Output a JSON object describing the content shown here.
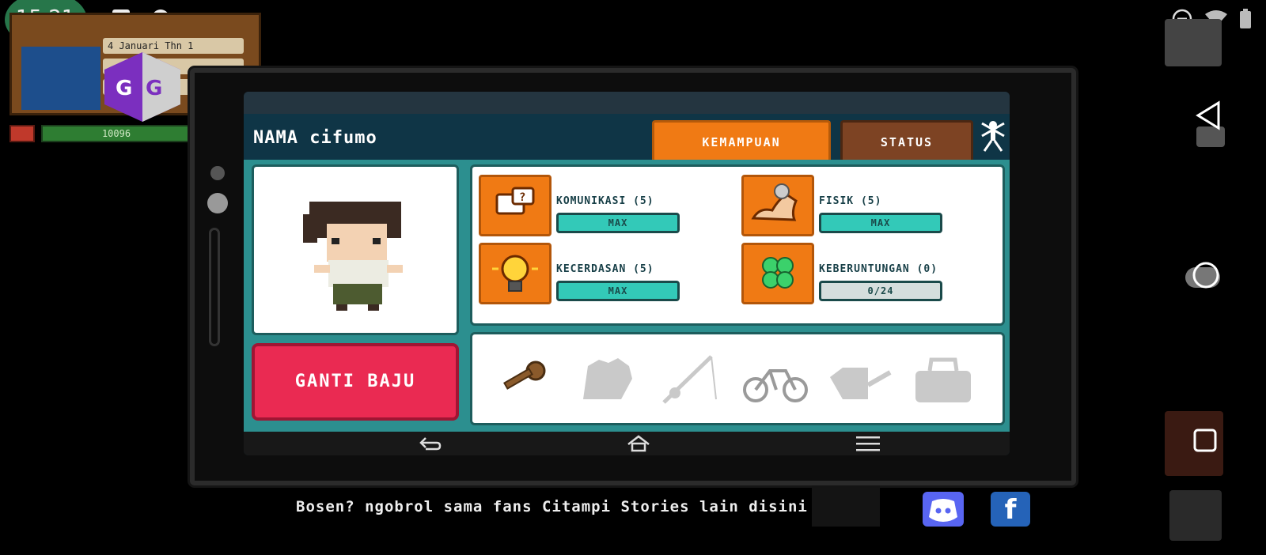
{
  "status_bar": {
    "time": "15.21",
    "left_icons": [
      "a-box-icon",
      "gg-small-icon"
    ],
    "right_icons": [
      "do-not-disturb-icon",
      "wifi-icon",
      "battery-icon"
    ]
  },
  "background_hud": {
    "date_label": "4 Januari Thn 1",
    "energy_value": "10096"
  },
  "tablet": {
    "player_name": "NAMA cifumo",
    "tabs": [
      {
        "label": "KEMAMPUAN",
        "active": true
      },
      {
        "label": "STATUS",
        "active": false
      }
    ],
    "skills": [
      {
        "label": "KOMUNIKASI (5)",
        "bar": "MAX",
        "icon": "speech-bubble-icon"
      },
      {
        "label": "FISIK (5)",
        "bar": "MAX",
        "icon": "flexed-arm-icon"
      },
      {
        "label": "KECERDASAN (5)",
        "bar": "MAX",
        "icon": "light-bulb-icon"
      },
      {
        "label": "KEBERUNTUNGAN (0)",
        "bar": "0/24",
        "icon": "clover-icon"
      }
    ],
    "change_clothes_button": "GANTI BAJU",
    "items": [
      "key-icon",
      "glove-icon",
      "fishing-rod-icon",
      "bicycle-icon",
      "watering-can-icon",
      "bag-icon"
    ]
  },
  "footer": {
    "text": "Bosen? ngobrol sama fans Citampi Stories lain disini"
  },
  "colors": {
    "accent_orange": "#f07a14",
    "tab_brown": "#7d4323",
    "teal": "#2c8f8f",
    "bar_teal": "#33c9b8",
    "button_red": "#ea2a52"
  }
}
